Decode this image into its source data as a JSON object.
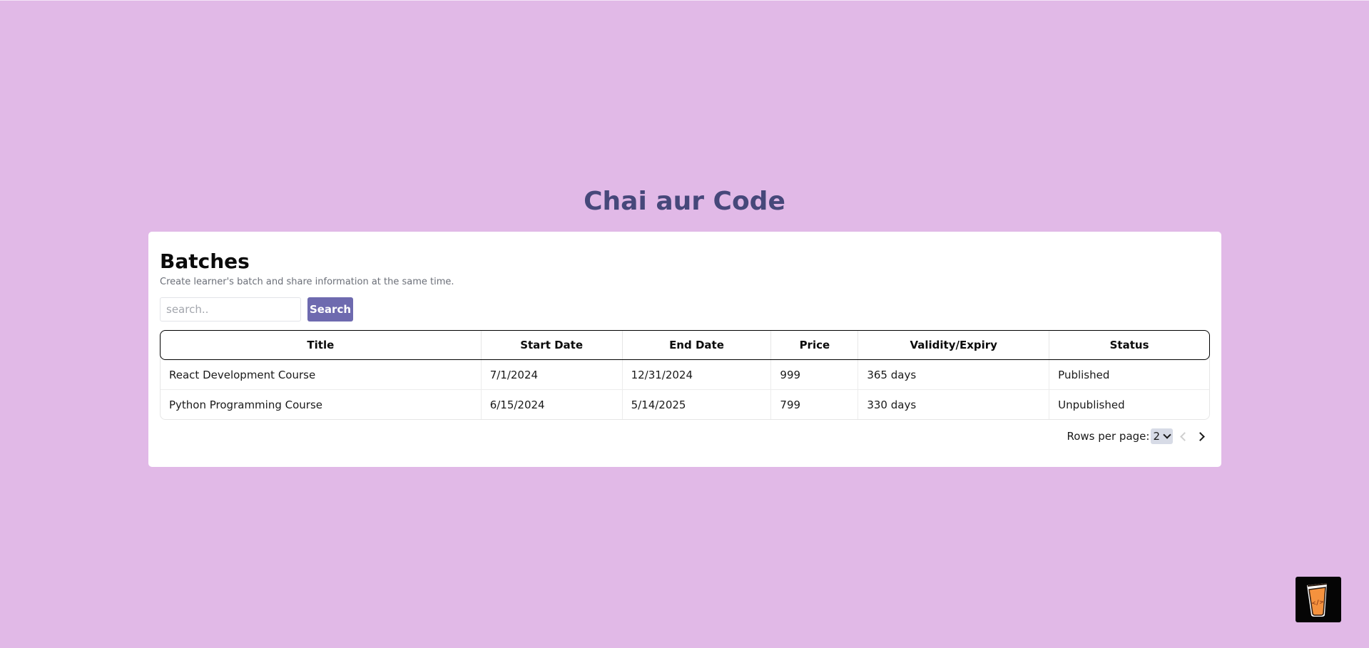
{
  "app": {
    "title": "Chai aur Code"
  },
  "batches": {
    "title": "Batches",
    "subtitle": "Create learner's batch and share information at the same time.",
    "search": {
      "placeholder": "search..",
      "value": "",
      "button_label": "Search"
    },
    "table": {
      "columns": [
        "Title",
        "Start Date",
        "End Date",
        "Price",
        "Validity/Expiry",
        "Status"
      ],
      "rows": [
        [
          "React Development Course",
          "7/1/2024",
          "12/31/2024",
          "999",
          "365 days",
          "Published"
        ],
        [
          "Python Programming Course",
          "6/15/2024",
          "5/14/2025",
          "799",
          "330 days",
          "Unpublished"
        ]
      ]
    },
    "pagination": {
      "rows_per_page_label": "Rows per page:",
      "rows_per_page_value": "2",
      "prev_icon": "chevron-left-icon",
      "next_icon": "chevron-right-icon"
    }
  },
  "colors": {
    "background": "#e1b9e7",
    "title": "#46487a",
    "accent": "#6e6aaf",
    "logo_bg": "#050505",
    "logo_cup": "#f5923e"
  },
  "logo": {
    "icon": "chai-cup-code-icon"
  }
}
